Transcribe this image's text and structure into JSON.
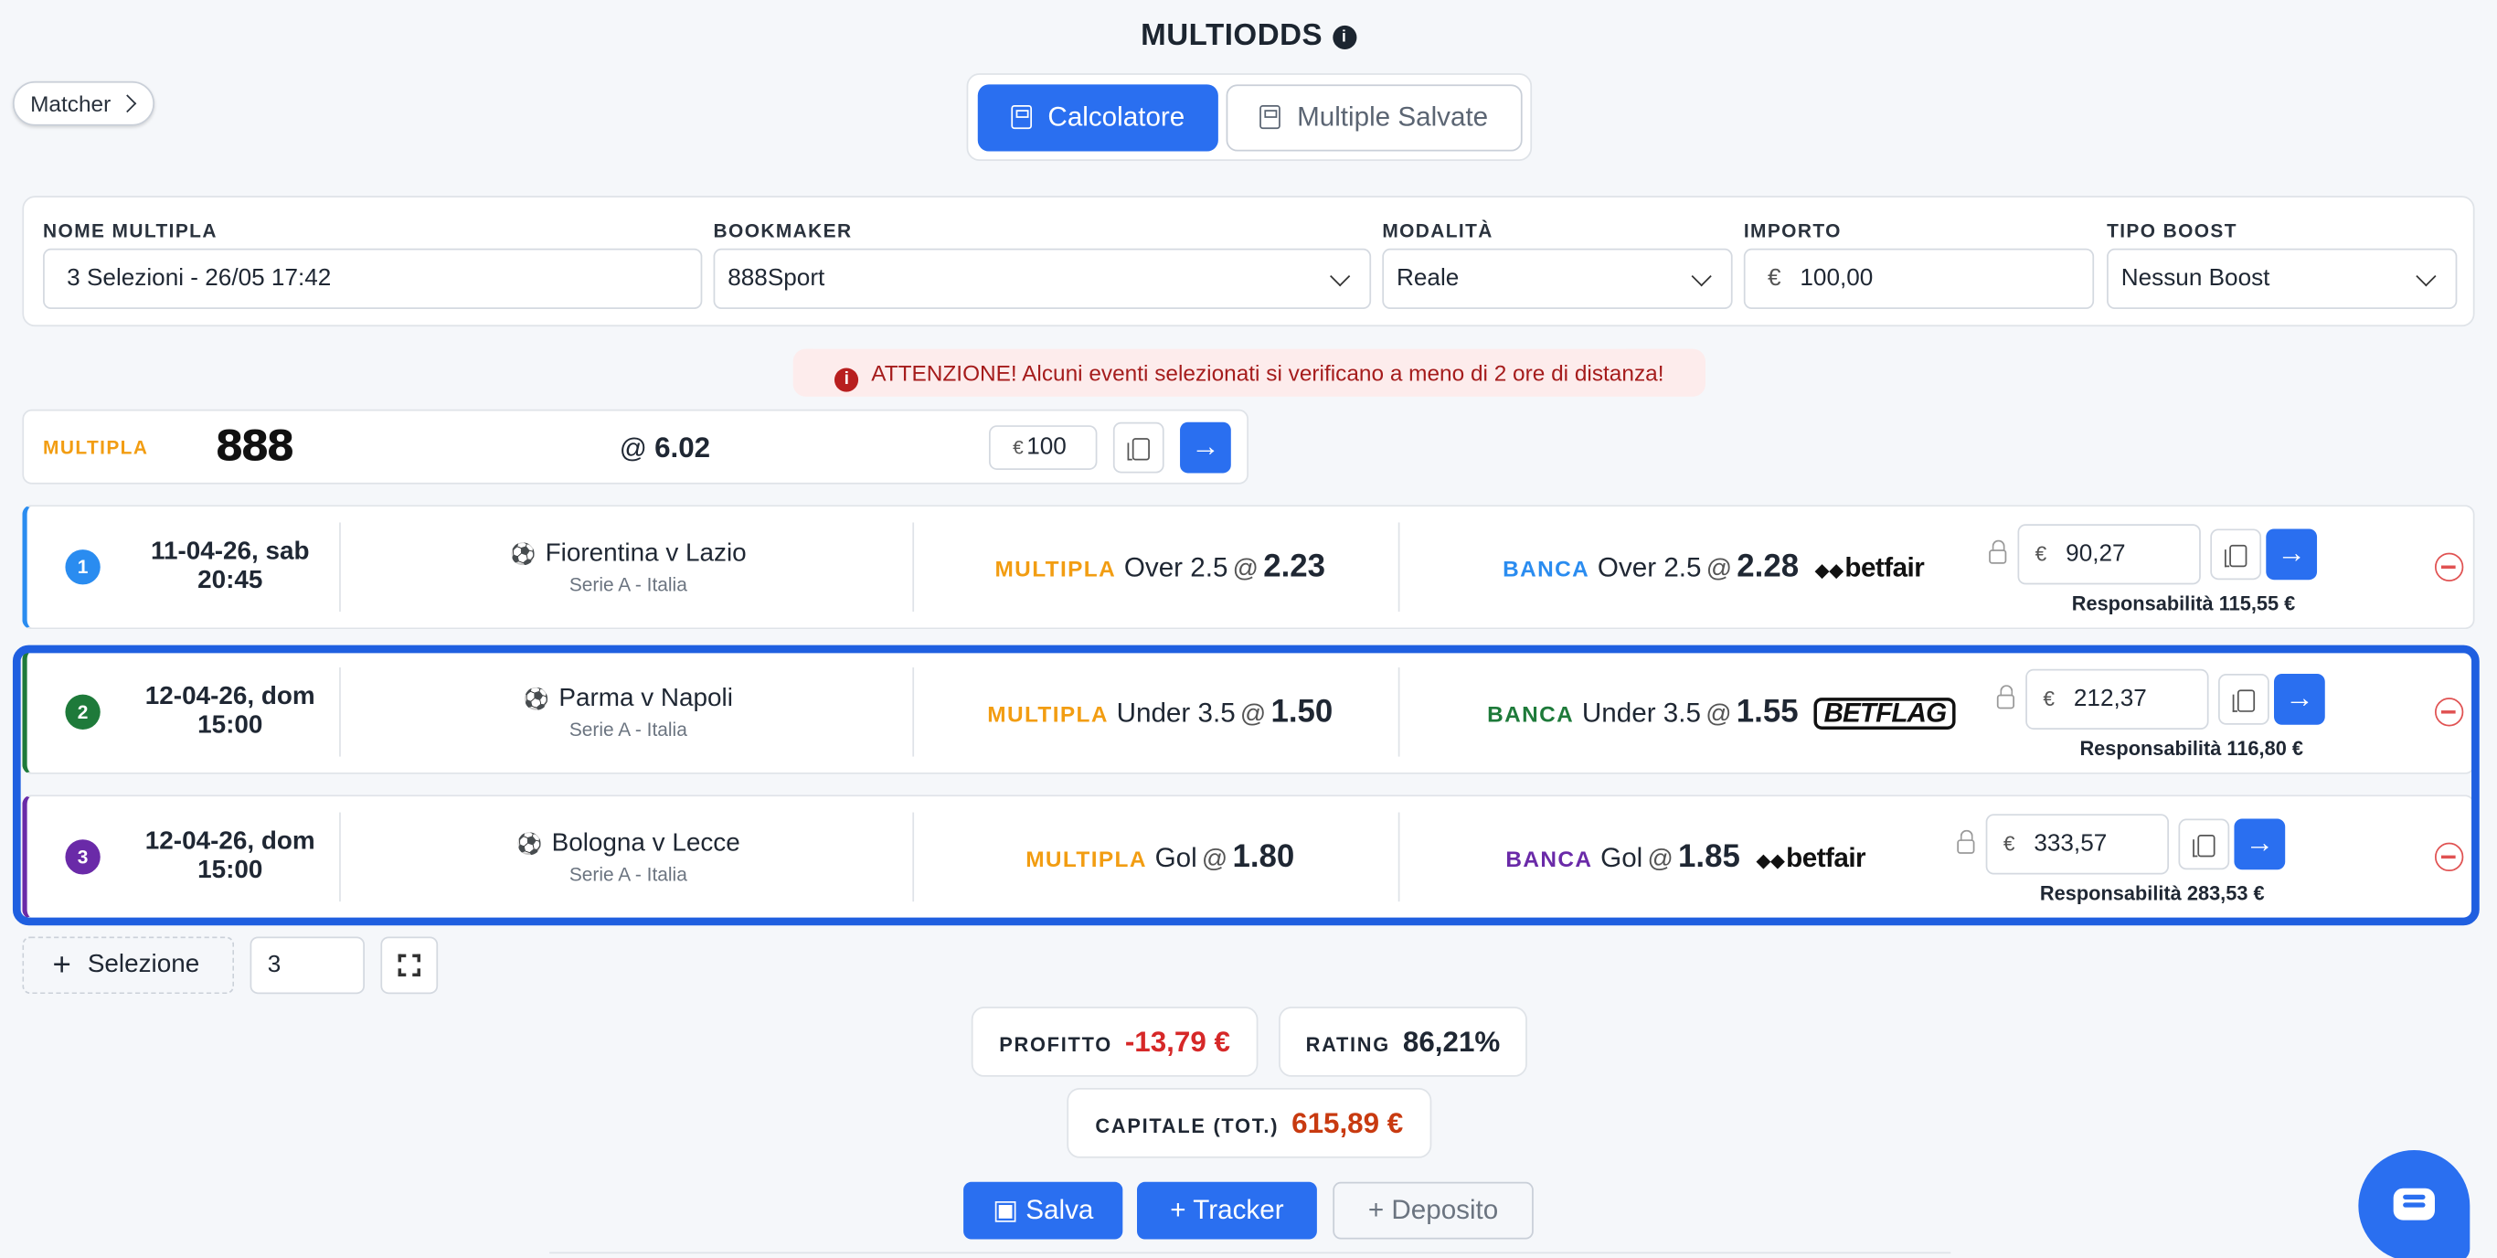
{
  "header": {
    "title": "MULTIODDS",
    "info_icon": "info-icon"
  },
  "matcher": {
    "label": "Matcher"
  },
  "tabs": [
    {
      "label": "Calcolatore",
      "active": true,
      "icon": "calculator-icon"
    },
    {
      "label": "Multiple Salvate",
      "active": false,
      "icon": "save-icon"
    }
  ],
  "form": {
    "name": {
      "label": "NOME MULTIPLA",
      "value": "3 Selezioni - 26/05 17:42"
    },
    "bookmaker": {
      "label": "BOOKMAKER",
      "value": "888Sport"
    },
    "mode": {
      "label": "MODALITÀ",
      "value": "Reale"
    },
    "amount": {
      "label": "IMPORTO",
      "currency": "€",
      "value": "100,00"
    },
    "boost": {
      "label": "TIPO BOOST",
      "value": "Nessun Boost"
    }
  },
  "warning": {
    "text": "ATTENZIONE! Alcuni eventi selezionati si verificano a meno di 2 ore di distanza!"
  },
  "multipla": {
    "label": "MULTIPLA",
    "logo": "888",
    "at": "@",
    "odds": "6.02",
    "currency": "€",
    "stake": "100"
  },
  "selections": [
    {
      "num": "1",
      "color": "#2a8cf0",
      "date": "11-04-26, sab",
      "time": "20:45",
      "event": "Fiorentina v Lazio",
      "league": "Serie A - Italia",
      "back_label": "MULTIPLA",
      "back_market": "Over 2.5",
      "back_odds": "2.23",
      "lay_label": "BANCA",
      "lay_market": "Over 2.5",
      "lay_odds": "2.28",
      "exchange": "betfair",
      "currency": "€",
      "lay_stake": "90,27",
      "responsibility": "Responsabilità 115,55 €"
    },
    {
      "num": "2",
      "color": "#1e7a3a",
      "date": "12-04-26, dom",
      "time": "15:00",
      "event": "Parma v Napoli",
      "league": "Serie A - Italia",
      "back_label": "MULTIPLA",
      "back_market": "Under 3.5",
      "back_odds": "1.50",
      "lay_label": "BANCA",
      "lay_market": "Under 3.5",
      "lay_odds": "1.55",
      "exchange": "BETFLAG",
      "currency": "€",
      "lay_stake": "212,37",
      "responsibility": "Responsabilità 116,80 €"
    },
    {
      "num": "3",
      "color": "#6a2aa8",
      "date": "12-04-26, dom",
      "time": "15:00",
      "event": "Bologna v Lecce",
      "league": "Serie A - Italia",
      "back_label": "MULTIPLA",
      "back_market": "Gol",
      "back_odds": "1.80",
      "lay_label": "BANCA",
      "lay_market": "Gol",
      "lay_odds": "1.85",
      "exchange": "betfair",
      "currency": "€",
      "lay_stake": "333,57",
      "responsibility": "Responsabilità 283,53 €"
    }
  ],
  "controls": {
    "add_label": "Selezione",
    "count": "3"
  },
  "stats": {
    "profit": {
      "label": "PROFITTO",
      "value": "-13,79 €",
      "color": "#d62828"
    },
    "rating": {
      "label": "RATING",
      "value": "86,21%"
    },
    "capital": {
      "label": "CAPITALE (TOT.)",
      "value": "615,89 €",
      "color": "#c83a10"
    }
  },
  "actions": {
    "save": "Salva",
    "tracker": "Tracker",
    "deposit": "Deposito"
  },
  "colors": {
    "accent": "#2a6ff0",
    "multipla": "#f29d12",
    "highlight": "#1f5fe0"
  }
}
